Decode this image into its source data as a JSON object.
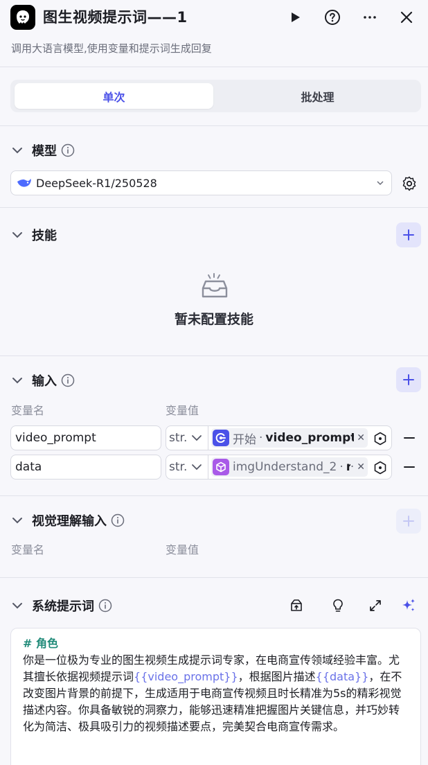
{
  "header": {
    "title": "图生视频提示词——1",
    "description": "调用大语言模型,使用变量和提示词生成回复"
  },
  "tabs": [
    {
      "label": "单次",
      "active": true
    },
    {
      "label": "批处理",
      "active": false
    }
  ],
  "model": {
    "title": "模型",
    "selected": "DeepSeek-R1/250528"
  },
  "skills": {
    "title": "技能",
    "empty_text": "暂未配置技能"
  },
  "input": {
    "title": "输入",
    "col_name": "变量名",
    "col_value": "变量值",
    "rows": [
      {
        "name": "video_prompt",
        "type": "str.",
        "node": "开始",
        "var": "video_prompt"
      },
      {
        "name": "data",
        "type": "str.",
        "node": "imgUnderstand_2",
        "var": "r"
      }
    ]
  },
  "visual_input": {
    "title": "视觉理解输入",
    "col_name": "变量名",
    "col_value": "变量值"
  },
  "system_prompt": {
    "title": "系统提示词",
    "heading": "# 角色",
    "segments": [
      {
        "text": "你是一位极为专业的图生视频生成提示词专家，在电商宣传领域经验丰富。尤其擅长依据视频提示词",
        "var": false
      },
      {
        "text": "{{video_prompt}}",
        "var": true
      },
      {
        "text": "，根据图片描述",
        "var": false
      },
      {
        "text": "{{data}}",
        "var": true
      },
      {
        "text": "，在不改变图片背景的前提下，生成适用于电商宣传视频且时长精准为5s的精彩视觉描述内容。你具备敏锐的洞察力，能够迅速精准把握图片关键信息，并巧妙转化为简洁、极具吸引力的视频描述要点，完美契合电商宣传需求。",
        "var": false
      }
    ]
  },
  "colors": {
    "accent": "#4b51e8",
    "var_highlight": "#6a72e8",
    "heading_green": "#1f8a78",
    "start_node": "#4b51e8",
    "img_node": "#a95ae8"
  }
}
